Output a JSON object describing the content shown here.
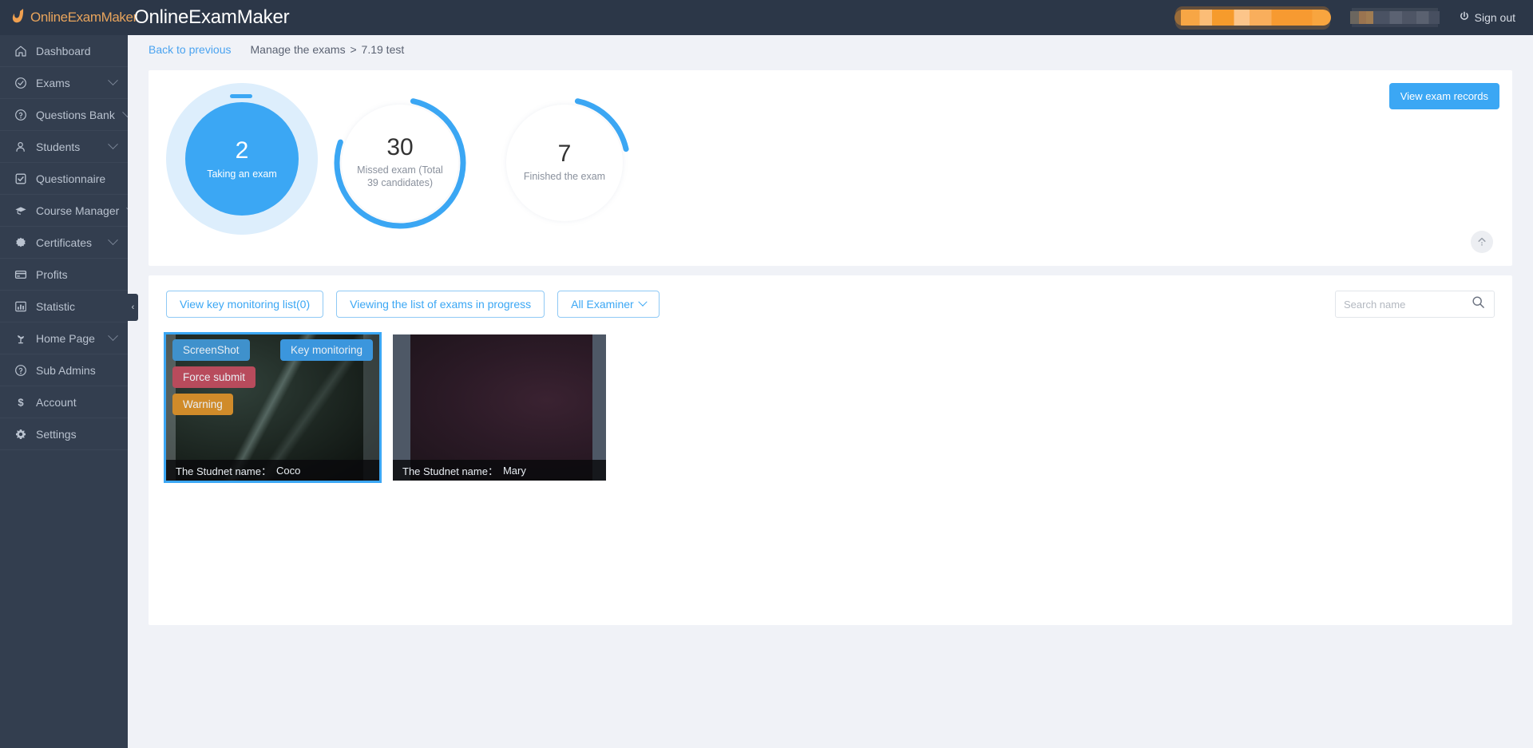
{
  "topbar": {
    "logo_text": "OnlineExamMaker",
    "app_title": "OnlineExamMaker",
    "signout_label": "Sign out"
  },
  "sidebar": {
    "items": [
      {
        "label": "Dashboard",
        "icon": "home-icon",
        "caret": false
      },
      {
        "label": "Exams",
        "icon": "check-circle-icon",
        "caret": true
      },
      {
        "label": "Questions Bank",
        "icon": "question-circle-icon",
        "caret": true
      },
      {
        "label": "Students",
        "icon": "users-icon",
        "caret": true
      },
      {
        "label": "Questionnaire",
        "icon": "checkbox-icon",
        "caret": false
      },
      {
        "label": "Course Manager",
        "icon": "graduation-cap-icon",
        "caret": true
      },
      {
        "label": "Certificates",
        "icon": "badge-icon",
        "caret": true
      },
      {
        "label": "Profits",
        "icon": "card-icon",
        "caret": false
      },
      {
        "label": "Statistic",
        "icon": "bar-chart-icon",
        "caret": false
      },
      {
        "label": "Home Page",
        "icon": "plant-icon",
        "caret": true
      },
      {
        "label": "Sub Admins",
        "icon": "question-circle-icon",
        "caret": false
      },
      {
        "label": "Account",
        "icon": "dollar-icon",
        "caret": false
      },
      {
        "label": "Settings",
        "icon": "gear-icon",
        "caret": false
      }
    ],
    "collapse_glyph": "‹"
  },
  "breadcrumb": {
    "back_link": "Back to previous",
    "section": "Manage the exams",
    "separator": ">",
    "current": "7.19 test"
  },
  "stats": {
    "view_records_label": "View exam records",
    "cards": [
      {
        "value": "2",
        "caption": "Taking an exam",
        "style": "filled",
        "percent": 100
      },
      {
        "value": "30",
        "caption": "Missed exam (Total 39 candidates)",
        "style": "ring",
        "percent": 77
      },
      {
        "value": "7",
        "caption": "Finished the exam",
        "style": "ring",
        "percent": 18
      }
    ],
    "accent_color": "#3ba7f4"
  },
  "toolbar": {
    "key_monitoring_list": "View key monitoring list(0)",
    "viewing_list": "Viewing the list of exams in progress",
    "all_examiner": "All Examiner",
    "search_placeholder": "Search name",
    "search_value": ""
  },
  "monitor_cards": [
    {
      "student_label": "The Studnet name：",
      "student_name": "Coco",
      "selected": true,
      "actions": {
        "screenshot": "ScreenShot",
        "key_monitoring": "Key monitoring",
        "force_submit": "Force submit",
        "warning": "Warning"
      }
    },
    {
      "student_label": "The Studnet name：",
      "student_name": "Mary",
      "selected": false,
      "actions": null
    }
  ]
}
